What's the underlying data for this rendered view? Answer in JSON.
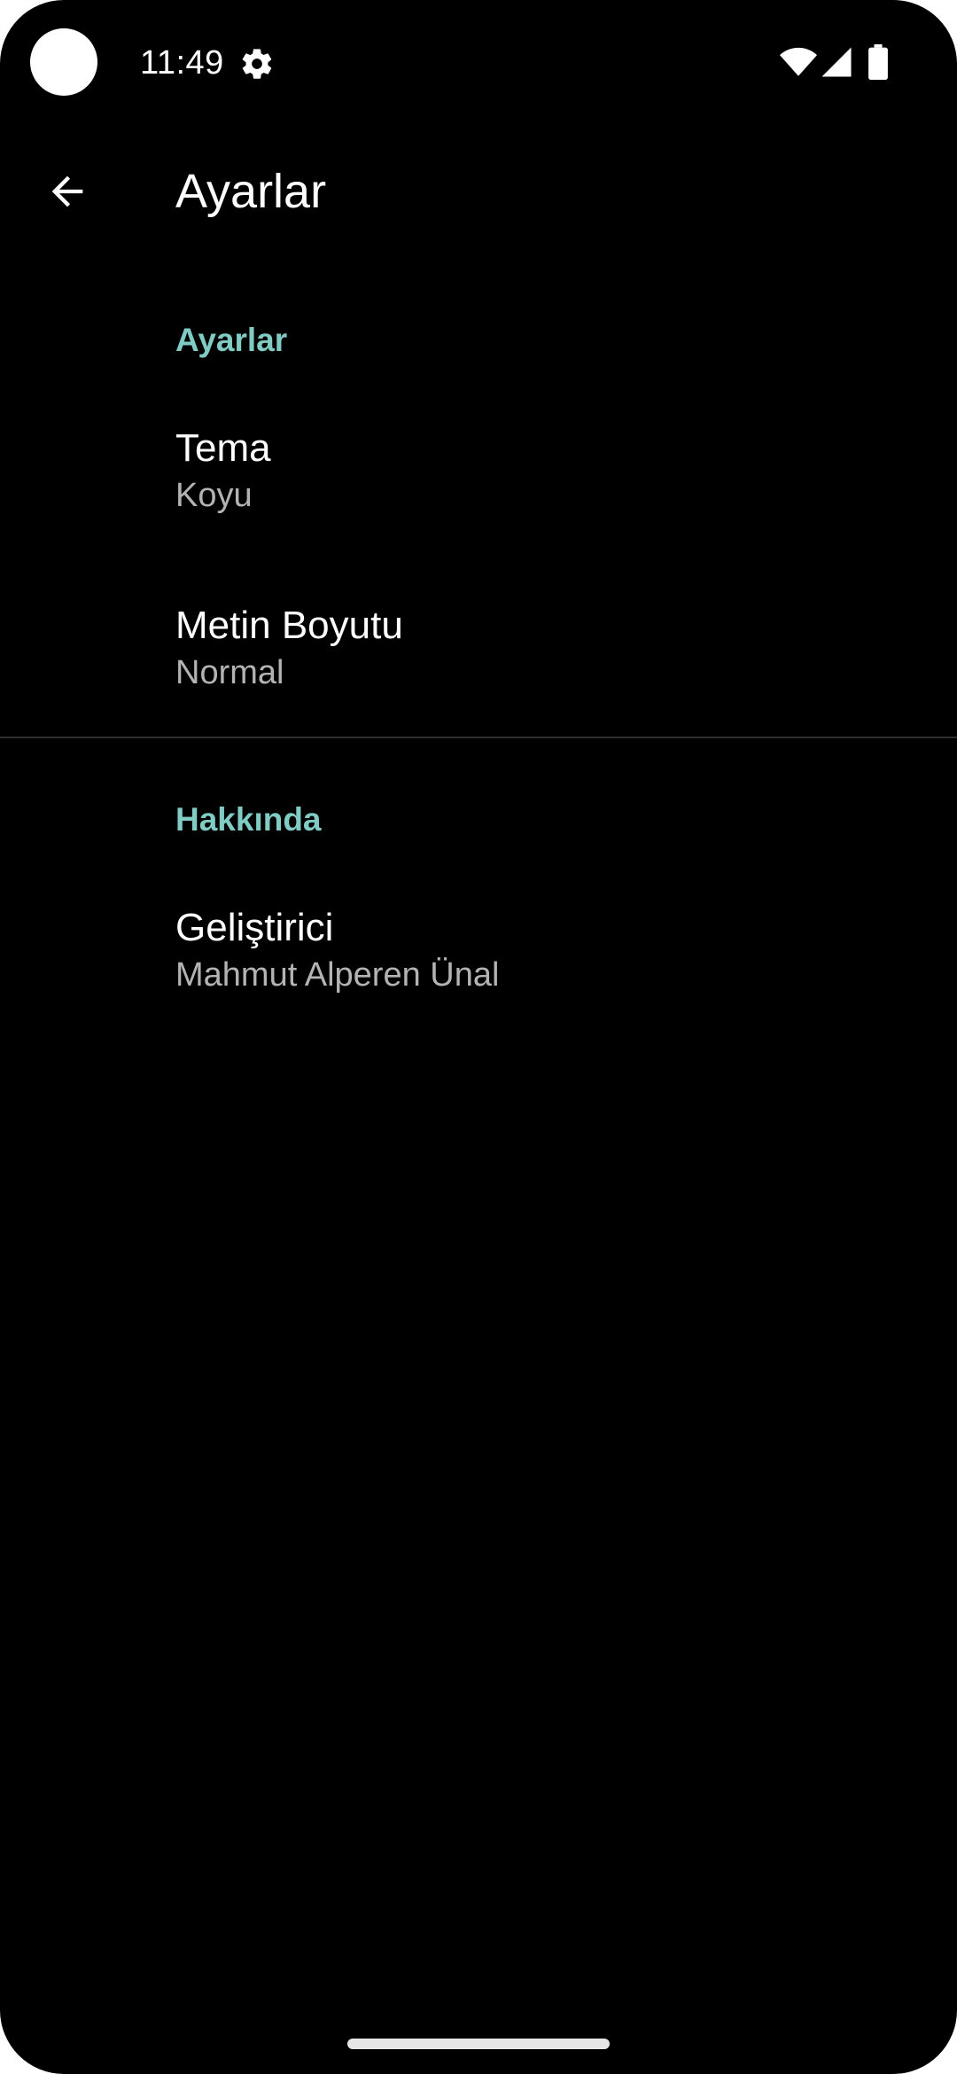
{
  "status_bar": {
    "time": "11:49",
    "icons": [
      "gear-icon",
      "wifi-icon",
      "signal-icon",
      "battery-icon"
    ]
  },
  "app_bar": {
    "back_icon": "arrow-back-icon",
    "title": "Ayarlar"
  },
  "sections": [
    {
      "header": "Ayarlar",
      "items": [
        {
          "title": "Tema",
          "summary": "Koyu"
        },
        {
          "title": "Metin Boyutu",
          "summary": "Normal"
        }
      ]
    },
    {
      "header": "Hakkında",
      "items": [
        {
          "title": "Geliştirici",
          "summary": "Mahmut Alperen Ünal"
        }
      ]
    }
  ],
  "colors": {
    "background": "#000000",
    "accent": "#80cbc4",
    "text_primary": "#ffffff",
    "text_secondary": "#b3b3b3",
    "divider": "#2e2e2e"
  }
}
